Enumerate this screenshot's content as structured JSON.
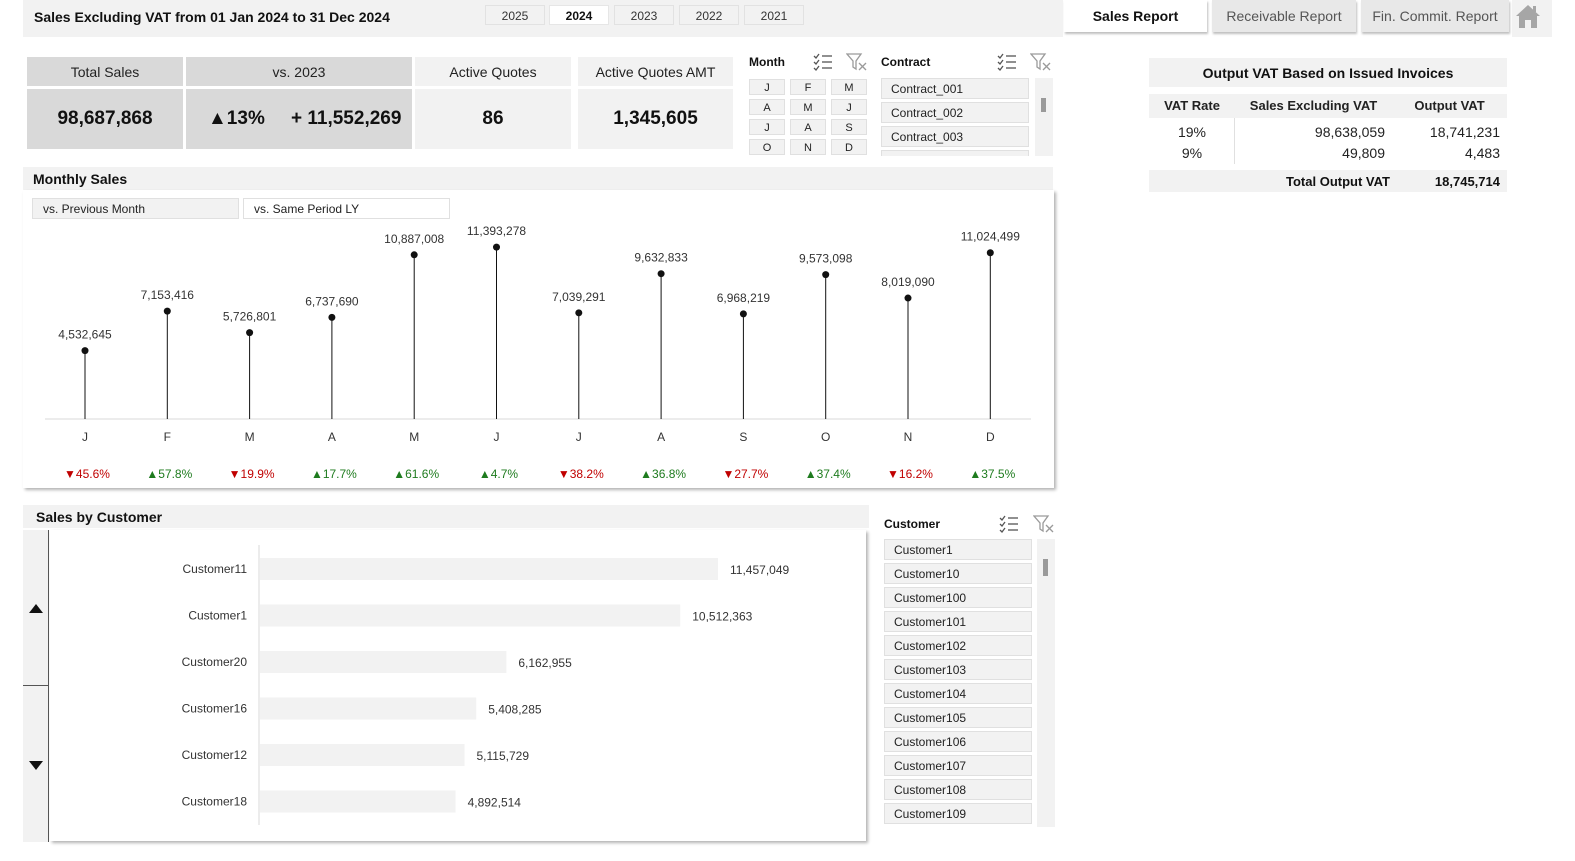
{
  "header": {
    "title": "Sales Excluding VAT from 01 Jan 2024 to 31 Dec 2024",
    "years": [
      "2025",
      "2024",
      "2023",
      "2022",
      "2021"
    ],
    "active_year": "2024",
    "nav": [
      "Sales Report",
      "Receivable Report",
      "Fin. Commit. Report"
    ],
    "active_nav": "Sales Report",
    "home_icon": "home-icon"
  },
  "kpis": {
    "total_sales_label": "Total Sales",
    "total_sales_value": "98,687,868",
    "vs_label": "vs. 2023",
    "vs_pct": "▲13%",
    "vs_abs": "+ 11,552,269",
    "active_quotes_label": "Active Quotes",
    "active_quotes_value": "86",
    "active_quotes_amt_label": "Active Quotes AMT",
    "active_quotes_amt_value": "1,345,605"
  },
  "month_slicer": {
    "title": "Month",
    "items": [
      "J",
      "F",
      "M",
      "A",
      "M",
      "J",
      "J",
      "A",
      "S",
      "O",
      "N",
      "D"
    ]
  },
  "contract_slicer": {
    "title": "Contract",
    "items": [
      "Contract_001",
      "Contract_002",
      "Contract_003"
    ]
  },
  "vat": {
    "title": "Output VAT Based on Issued Invoices",
    "headers": [
      "VAT Rate",
      "Sales Excluding VAT",
      "Output VAT"
    ],
    "rows": [
      {
        "rate": "19%",
        "sales": "98,638,059",
        "vat": "18,741,231"
      },
      {
        "rate": "9%",
        "sales": "49,809",
        "vat": "4,483"
      }
    ],
    "total_label": "Total Output VAT",
    "total_value": "18,745,714"
  },
  "monthly": {
    "title": "Monthly Sales",
    "toggle_prev": "vs. Previous Month",
    "toggle_ly": "vs. Same Period LY"
  },
  "customer": {
    "title": "Sales by Customer",
    "slicer_title": "Customer",
    "slicer_items": [
      "Customer1",
      "Customer10",
      "Customer100",
      "Customer101",
      "Customer102",
      "Customer103",
      "Customer104",
      "Customer105",
      "Customer106",
      "Customer107",
      "Customer108",
      "Customer109"
    ]
  },
  "colors": {
    "up": "#1e7b1e",
    "down": "#c00000",
    "panel": "#f2f2f2",
    "kpi_dark": "#d9d9d9",
    "bar": "#f2f2f2"
  },
  "chart_data": [
    {
      "type": "line",
      "title": "Monthly Sales",
      "categories": [
        "J",
        "F",
        "M",
        "A",
        "M",
        "J",
        "J",
        "A",
        "S",
        "O",
        "N",
        "D"
      ],
      "values": [
        4532645,
        7153416,
        5726801,
        6737690,
        10887008,
        11393278,
        7039291,
        9632833,
        6968219,
        9573098,
        8019090,
        11024499
      ],
      "labels": [
        "4,532,645",
        "7,153,416",
        "5,726,801",
        "6,737,690",
        "10,887,008",
        "11,393,278",
        "7,039,291",
        "9,632,833",
        "6,968,219",
        "9,573,098",
        "8,019,090",
        "11,024,499"
      ],
      "changes": [
        {
          "dir": "down",
          "text": "▼45.6%"
        },
        {
          "dir": "up",
          "text": "▲57.8%"
        },
        {
          "dir": "down",
          "text": "▼19.9%"
        },
        {
          "dir": "up",
          "text": "▲17.7%"
        },
        {
          "dir": "up",
          "text": "▲61.6%"
        },
        {
          "dir": "up",
          "text": "▲4.7%"
        },
        {
          "dir": "down",
          "text": "▼38.2%"
        },
        {
          "dir": "up",
          "text": "▲36.8%"
        },
        {
          "dir": "down",
          "text": "▼27.7%"
        },
        {
          "dir": "up",
          "text": "▲37.4%"
        },
        {
          "dir": "down",
          "text": "▼16.2%"
        },
        {
          "dir": "up",
          "text": "▲37.5%"
        }
      ],
      "ylim": [
        0,
        12000000
      ],
      "grid": false
    },
    {
      "type": "bar",
      "title": "Sales by Customer",
      "categories": [
        "Customer11",
        "Customer1",
        "Customer20",
        "Customer16",
        "Customer12",
        "Customer18"
      ],
      "values": [
        11457049,
        10512363,
        6162955,
        5408285,
        5115729,
        4892514
      ],
      "labels": [
        "11,457,049",
        "10,512,363",
        "6,162,955",
        "5,408,285",
        "5,115,729",
        "4,892,514"
      ],
      "orientation": "horizontal",
      "xlim": [
        0,
        11457049
      ]
    }
  ]
}
